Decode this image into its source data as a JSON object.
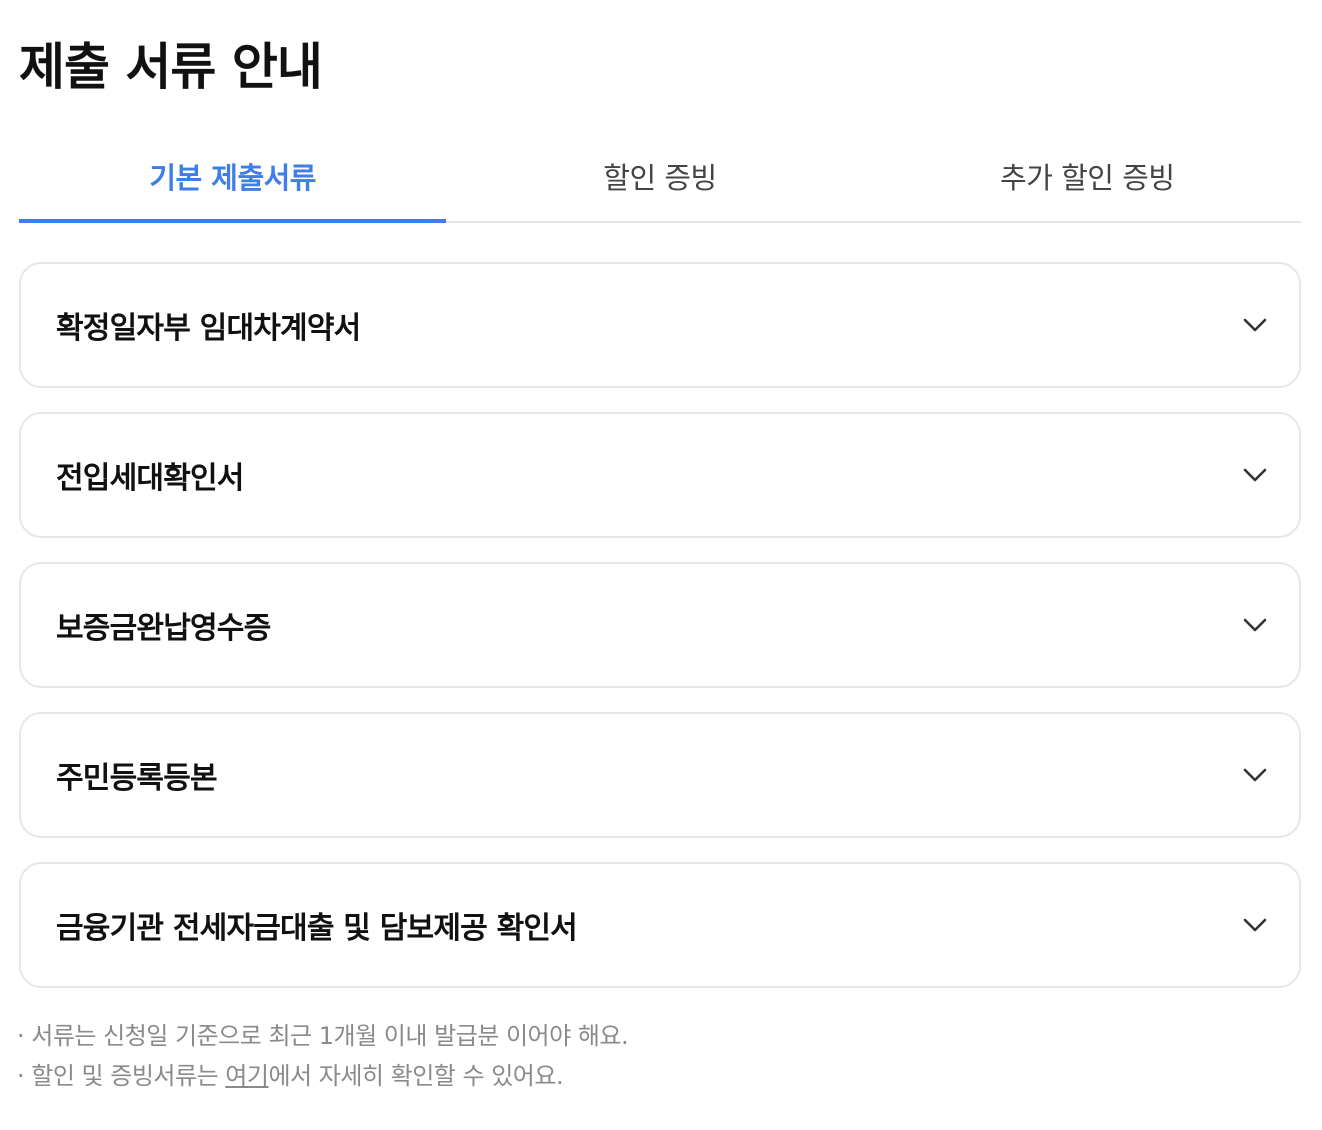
{
  "page": {
    "title": "제출 서류 안내"
  },
  "tabs": [
    {
      "label": "기본 제출서류",
      "active": true
    },
    {
      "label": "할인 증빙",
      "active": false
    },
    {
      "label": "추가 할인 증빙",
      "active": false
    }
  ],
  "documents": [
    {
      "label": "확정일자부 임대차계약서"
    },
    {
      "label": "전입세대확인서"
    },
    {
      "label": "보증금완납영수증"
    },
    {
      "label": "주민등록등본"
    },
    {
      "label": "금융기관 전세자금대출 및 담보제공 확인서"
    }
  ],
  "icons": {
    "expand": "chevron-down-icon"
  },
  "notes": {
    "line1": "서류는 신청일 기준으로 최근 1개월 이내 발급분 이어야 해요.",
    "line2_before": "할인 및 증빙서류는 ",
    "line2_link": "여기",
    "line2_after": "에서 자세히 확인할 수 있어요."
  },
  "colors": {
    "accent": "#3f7ee8",
    "border": "#e7e7e7",
    "note_text": "#8a8a8a"
  }
}
